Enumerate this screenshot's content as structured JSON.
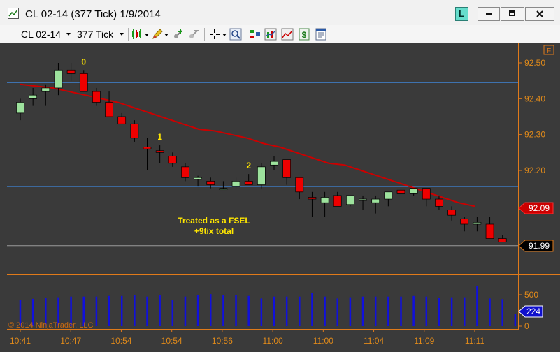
{
  "window": {
    "title": "CL 02-14 (377 Tick)  1/9/2014",
    "link_button": "L"
  },
  "toolbar": {
    "instrument": "CL 02-14",
    "interval": "377 Tick"
  },
  "chart_data": {
    "type": "candlestick",
    "price_ylim": [
      91.92,
      92.57
    ],
    "price_ticks": [
      "92.50",
      "92.40",
      "92.30",
      "92.20"
    ],
    "volume_ticks": [
      "500",
      "0"
    ],
    "x_tick_labels": [
      "10:41",
      "10:47",
      "10:54",
      "10:54",
      "10:56",
      "11:00",
      "11:00",
      "11:04",
      "11:09",
      "11:11"
    ],
    "ma_price_badge": "92.09",
    "last_price_badge": "91.99",
    "volume_badge": "224",
    "panel_marker": "F",
    "copyright": "© 2014 NinjaTrader, LLC",
    "annotation": [
      "Treated as a FSEL",
      "+9tix total"
    ],
    "swing_labels": [
      {
        "text": "0",
        "bar": 5
      },
      {
        "text": "1",
        "bar": 11
      },
      {
        "text": "2",
        "bar": 18
      }
    ],
    "hlines": [
      92.445,
      92.155,
      91.99
    ],
    "bars": [
      {
        "o": 92.36,
        "h": 92.4,
        "l": 92.34,
        "c": 92.39
      },
      {
        "o": 92.4,
        "h": 92.43,
        "l": 92.38,
        "c": 92.41
      },
      {
        "o": 92.42,
        "h": 92.44,
        "l": 92.38,
        "c": 92.43
      },
      {
        "o": 92.43,
        "h": 92.5,
        "l": 92.41,
        "c": 92.48
      },
      {
        "o": 92.48,
        "h": 92.5,
        "l": 92.45,
        "c": 92.47
      },
      {
        "o": 92.47,
        "h": 92.48,
        "l": 92.42,
        "c": 92.42
      },
      {
        "o": 92.42,
        "h": 92.43,
        "l": 92.38,
        "c": 92.39
      },
      {
        "o": 92.39,
        "h": 92.42,
        "l": 92.35,
        "c": 92.35
      },
      {
        "o": 92.35,
        "h": 92.36,
        "l": 92.33,
        "c": 92.33
      },
      {
        "o": 92.33,
        "h": 92.34,
        "l": 92.28,
        "c": 92.29
      },
      {
        "o": 92.265,
        "h": 92.29,
        "l": 92.2,
        "c": 92.26
      },
      {
        "o": 92.255,
        "h": 92.27,
        "l": 92.22,
        "c": 92.25
      },
      {
        "o": 92.24,
        "h": 92.25,
        "l": 92.21,
        "c": 92.22
      },
      {
        "o": 92.21,
        "h": 92.22,
        "l": 92.17,
        "c": 92.18
      },
      {
        "o": 92.175,
        "h": 92.185,
        "l": 92.155,
        "c": 92.18
      },
      {
        "o": 92.17,
        "h": 92.18,
        "l": 92.15,
        "c": 92.16
      },
      {
        "o": 92.15,
        "h": 92.17,
        "l": 92.15,
        "c": 92.15
      },
      {
        "o": 92.155,
        "h": 92.18,
        "l": 92.15,
        "c": 92.17
      },
      {
        "o": 92.17,
        "h": 92.19,
        "l": 92.16,
        "c": 92.16
      },
      {
        "o": 92.16,
        "h": 92.22,
        "l": 92.15,
        "c": 92.21
      },
      {
        "o": 92.215,
        "h": 92.24,
        "l": 92.2,
        "c": 92.225
      },
      {
        "o": 92.23,
        "h": 92.23,
        "l": 92.16,
        "c": 92.18
      },
      {
        "o": 92.18,
        "h": 92.18,
        "l": 92.12,
        "c": 92.14
      },
      {
        "o": 92.125,
        "h": 92.14,
        "l": 92.07,
        "c": 92.12
      },
      {
        "o": 92.11,
        "h": 92.14,
        "l": 92.07,
        "c": 92.125
      },
      {
        "o": 92.13,
        "h": 92.14,
        "l": 92.1,
        "c": 92.1
      },
      {
        "o": 92.105,
        "h": 92.13,
        "l": 92.1,
        "c": 92.13
      },
      {
        "o": 92.12,
        "h": 92.13,
        "l": 92.09,
        "c": 92.12
      },
      {
        "o": 92.11,
        "h": 92.13,
        "l": 92.08,
        "c": 92.12
      },
      {
        "o": 92.12,
        "h": 92.14,
        "l": 92.1,
        "c": 92.14
      },
      {
        "o": 92.145,
        "h": 92.16,
        "l": 92.12,
        "c": 92.135
      },
      {
        "o": 92.135,
        "h": 92.15,
        "l": 92.13,
        "c": 92.15
      },
      {
        "o": 92.15,
        "h": 92.15,
        "l": 92.1,
        "c": 92.12
      },
      {
        "o": 92.12,
        "h": 92.13,
        "l": 92.09,
        "c": 92.1
      },
      {
        "o": 92.09,
        "h": 92.1,
        "l": 92.06,
        "c": 92.075
      },
      {
        "o": 92.065,
        "h": 92.07,
        "l": 92.03,
        "c": 92.05
      },
      {
        "o": 92.05,
        "h": 92.07,
        "l": 92.03,
        "c": 92.055
      },
      {
        "o": 92.05,
        "h": 92.07,
        "l": 92.01,
        "c": 92.01
      },
      {
        "o": 92.01,
        "h": 92.02,
        "l": 92.0,
        "c": 92.0
      }
    ],
    "volume": [
      420,
      435,
      450,
      460,
      470,
      470,
      470,
      480,
      480,
      500,
      470,
      500,
      420,
      470,
      500,
      510,
      500,
      490,
      480,
      440,
      470,
      470,
      470,
      530,
      470,
      440,
      460,
      470,
      470,
      470,
      470,
      480,
      470,
      450,
      460,
      460,
      640,
      440,
      430,
      200
    ],
    "ma": [
      92.44,
      92.435,
      92.43,
      92.42,
      92.41,
      92.4,
      92.39,
      92.375,
      92.36,
      92.345,
      92.33,
      92.315,
      92.31,
      92.3,
      92.29,
      92.275,
      92.265,
      92.25,
      92.235,
      92.22,
      92.215,
      92.2,
      92.185,
      92.17,
      92.155,
      92.14,
      92.125,
      92.11,
      92.1
    ]
  }
}
